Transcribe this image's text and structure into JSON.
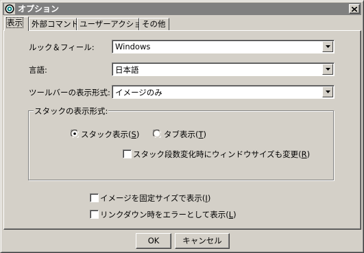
{
  "window": {
    "title": "オプション",
    "close_icon": "close-icon",
    "app_icon": "gear-app-icon"
  },
  "tabs": [
    {
      "label": "表示",
      "active": true
    },
    {
      "label": "外部コマンド",
      "active": false
    },
    {
      "label": "ユーザーアクション",
      "active": false
    },
    {
      "label": "その他",
      "active": false
    }
  ],
  "fields": {
    "look_and_feel": {
      "label": "ルック＆フィール:",
      "value": "Windows"
    },
    "language": {
      "label": "言語:",
      "value": "日本語"
    },
    "toolbar_display": {
      "label": "ツールバーの表示形式:",
      "value": "イメージのみ"
    }
  },
  "stack_group": {
    "title": "スタックの表示形式:",
    "radio_stack": {
      "text": "スタック表示(",
      "mnemonic": "S",
      "suffix": ")",
      "selected": true
    },
    "radio_tab": {
      "text": "タブ表示(",
      "mnemonic": "T",
      "suffix": ")",
      "selected": false
    },
    "check_change_window": {
      "text": "スタック段数変化時にウィンドウサイズも変更(",
      "mnemonic": "R",
      "suffix": ")",
      "checked": false
    }
  },
  "options": {
    "fixed_image_size": {
      "text": "イメージを固定サイズで表示(",
      "mnemonic": "I",
      "suffix": ")",
      "checked": false
    },
    "link_down_error": {
      "text": "リンクダウン時をエラーとして表示(",
      "mnemonic": "L",
      "suffix": ")",
      "checked": false
    }
  },
  "buttons": {
    "ok": "OK",
    "cancel": "キャンセル"
  },
  "colors": {
    "face": "#d4d0c8",
    "titlebar_inactive": "#808080",
    "field_bg": "#ffffff"
  }
}
